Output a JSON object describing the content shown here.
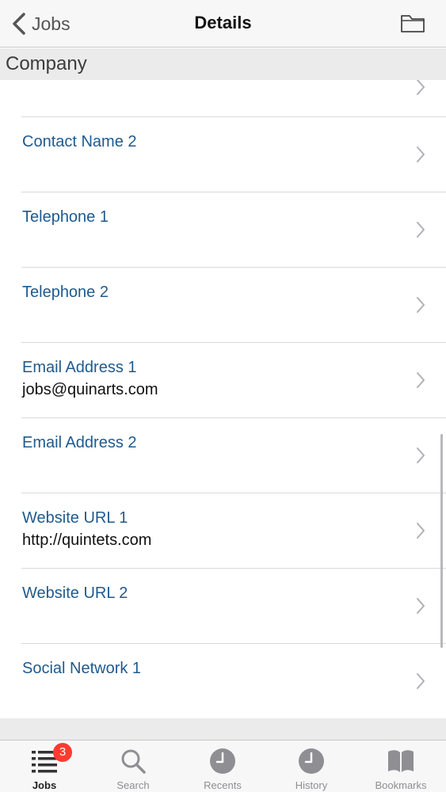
{
  "nav": {
    "back_label": "Jobs",
    "title": "Details"
  },
  "section": {
    "title": "Company"
  },
  "rows": [
    {
      "label": "Contact Name 2",
      "value": ""
    },
    {
      "label": "Telephone 1",
      "value": ""
    },
    {
      "label": "Telephone 2",
      "value": ""
    },
    {
      "label": "Email Address 1",
      "value": "jobs@quinarts.com"
    },
    {
      "label": "Email Address 2",
      "value": ""
    },
    {
      "label": "Website URL 1",
      "value": "http://quintets.com"
    },
    {
      "label": "Website URL 2",
      "value": ""
    },
    {
      "label": "Social Network 1",
      "value": ""
    }
  ],
  "tabs": [
    {
      "label": "Jobs",
      "icon": "list-icon",
      "badge": "3",
      "active": true
    },
    {
      "label": "Search",
      "icon": "search-icon"
    },
    {
      "label": "Recents",
      "icon": "clock-icon"
    },
    {
      "label": "History",
      "icon": "clock-icon"
    },
    {
      "label": "Bookmarks",
      "icon": "book-icon"
    }
  ],
  "colors": {
    "label_blue": "#1f5a8e",
    "badge_red": "#ff3b30"
  }
}
